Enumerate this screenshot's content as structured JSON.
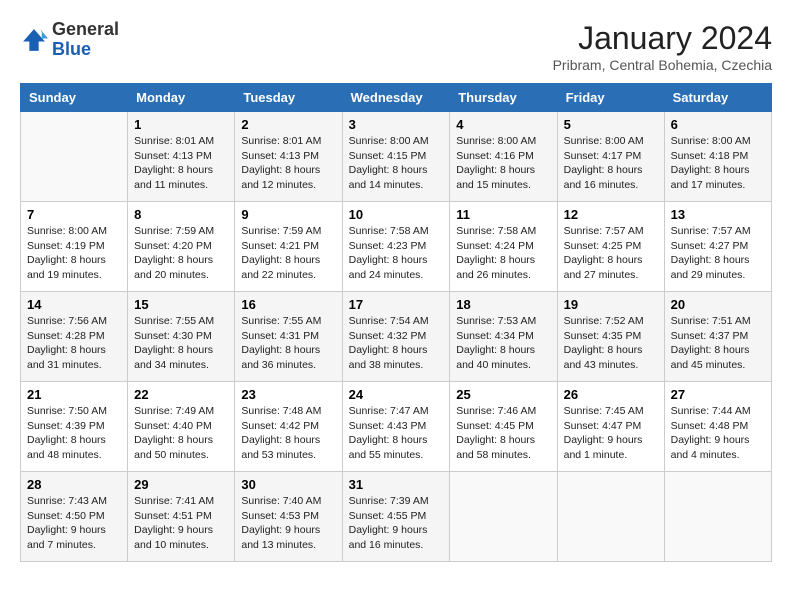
{
  "logo": {
    "general": "General",
    "blue": "Blue"
  },
  "header": {
    "month": "January 2024",
    "location": "Pribram, Central Bohemia, Czechia"
  },
  "columns": [
    "Sunday",
    "Monday",
    "Tuesday",
    "Wednesday",
    "Thursday",
    "Friday",
    "Saturday"
  ],
  "weeks": [
    [
      {
        "day": "",
        "info": ""
      },
      {
        "day": "1",
        "info": "Sunrise: 8:01 AM\nSunset: 4:13 PM\nDaylight: 8 hours\nand 11 minutes."
      },
      {
        "day": "2",
        "info": "Sunrise: 8:01 AM\nSunset: 4:13 PM\nDaylight: 8 hours\nand 12 minutes."
      },
      {
        "day": "3",
        "info": "Sunrise: 8:00 AM\nSunset: 4:15 PM\nDaylight: 8 hours\nand 14 minutes."
      },
      {
        "day": "4",
        "info": "Sunrise: 8:00 AM\nSunset: 4:16 PM\nDaylight: 8 hours\nand 15 minutes."
      },
      {
        "day": "5",
        "info": "Sunrise: 8:00 AM\nSunset: 4:17 PM\nDaylight: 8 hours\nand 16 minutes."
      },
      {
        "day": "6",
        "info": "Sunrise: 8:00 AM\nSunset: 4:18 PM\nDaylight: 8 hours\nand 17 minutes."
      }
    ],
    [
      {
        "day": "7",
        "info": "Sunrise: 8:00 AM\nSunset: 4:19 PM\nDaylight: 8 hours\nand 19 minutes."
      },
      {
        "day": "8",
        "info": "Sunrise: 7:59 AM\nSunset: 4:20 PM\nDaylight: 8 hours\nand 20 minutes."
      },
      {
        "day": "9",
        "info": "Sunrise: 7:59 AM\nSunset: 4:21 PM\nDaylight: 8 hours\nand 22 minutes."
      },
      {
        "day": "10",
        "info": "Sunrise: 7:58 AM\nSunset: 4:23 PM\nDaylight: 8 hours\nand 24 minutes."
      },
      {
        "day": "11",
        "info": "Sunrise: 7:58 AM\nSunset: 4:24 PM\nDaylight: 8 hours\nand 26 minutes."
      },
      {
        "day": "12",
        "info": "Sunrise: 7:57 AM\nSunset: 4:25 PM\nDaylight: 8 hours\nand 27 minutes."
      },
      {
        "day": "13",
        "info": "Sunrise: 7:57 AM\nSunset: 4:27 PM\nDaylight: 8 hours\nand 29 minutes."
      }
    ],
    [
      {
        "day": "14",
        "info": "Sunrise: 7:56 AM\nSunset: 4:28 PM\nDaylight: 8 hours\nand 31 minutes."
      },
      {
        "day": "15",
        "info": "Sunrise: 7:55 AM\nSunset: 4:30 PM\nDaylight: 8 hours\nand 34 minutes."
      },
      {
        "day": "16",
        "info": "Sunrise: 7:55 AM\nSunset: 4:31 PM\nDaylight: 8 hours\nand 36 minutes."
      },
      {
        "day": "17",
        "info": "Sunrise: 7:54 AM\nSunset: 4:32 PM\nDaylight: 8 hours\nand 38 minutes."
      },
      {
        "day": "18",
        "info": "Sunrise: 7:53 AM\nSunset: 4:34 PM\nDaylight: 8 hours\nand 40 minutes."
      },
      {
        "day": "19",
        "info": "Sunrise: 7:52 AM\nSunset: 4:35 PM\nDaylight: 8 hours\nand 43 minutes."
      },
      {
        "day": "20",
        "info": "Sunrise: 7:51 AM\nSunset: 4:37 PM\nDaylight: 8 hours\nand 45 minutes."
      }
    ],
    [
      {
        "day": "21",
        "info": "Sunrise: 7:50 AM\nSunset: 4:39 PM\nDaylight: 8 hours\nand 48 minutes."
      },
      {
        "day": "22",
        "info": "Sunrise: 7:49 AM\nSunset: 4:40 PM\nDaylight: 8 hours\nand 50 minutes."
      },
      {
        "day": "23",
        "info": "Sunrise: 7:48 AM\nSunset: 4:42 PM\nDaylight: 8 hours\nand 53 minutes."
      },
      {
        "day": "24",
        "info": "Sunrise: 7:47 AM\nSunset: 4:43 PM\nDaylight: 8 hours\nand 55 minutes."
      },
      {
        "day": "25",
        "info": "Sunrise: 7:46 AM\nSunset: 4:45 PM\nDaylight: 8 hours\nand 58 minutes."
      },
      {
        "day": "26",
        "info": "Sunrise: 7:45 AM\nSunset: 4:47 PM\nDaylight: 9 hours\nand 1 minute."
      },
      {
        "day": "27",
        "info": "Sunrise: 7:44 AM\nSunset: 4:48 PM\nDaylight: 9 hours\nand 4 minutes."
      }
    ],
    [
      {
        "day": "28",
        "info": "Sunrise: 7:43 AM\nSunset: 4:50 PM\nDaylight: 9 hours\nand 7 minutes."
      },
      {
        "day": "29",
        "info": "Sunrise: 7:41 AM\nSunset: 4:51 PM\nDaylight: 9 hours\nand 10 minutes."
      },
      {
        "day": "30",
        "info": "Sunrise: 7:40 AM\nSunset: 4:53 PM\nDaylight: 9 hours\nand 13 minutes."
      },
      {
        "day": "31",
        "info": "Sunrise: 7:39 AM\nSunset: 4:55 PM\nDaylight: 9 hours\nand 16 minutes."
      },
      {
        "day": "",
        "info": ""
      },
      {
        "day": "",
        "info": ""
      },
      {
        "day": "",
        "info": ""
      }
    ]
  ]
}
